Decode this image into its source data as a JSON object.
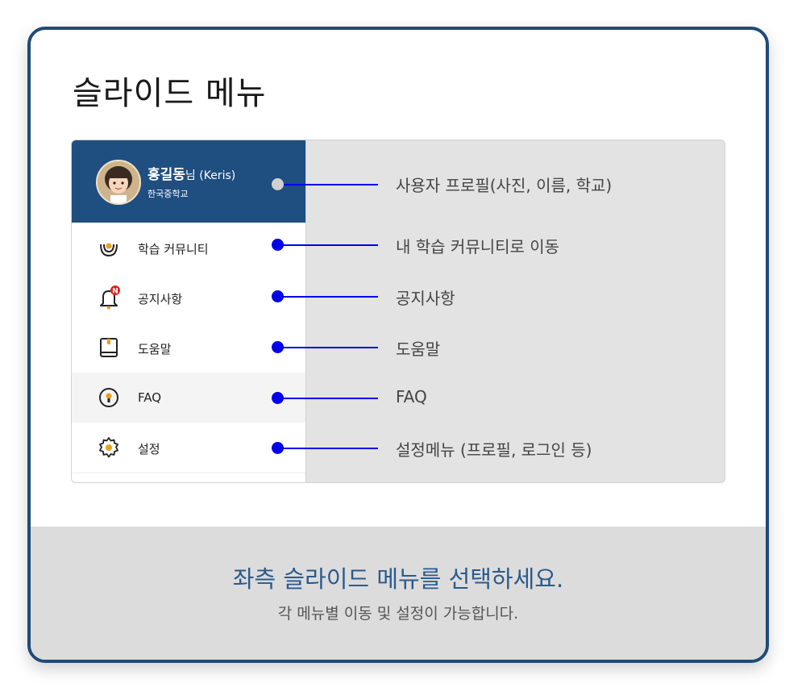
{
  "title": "슬라이드 메뉴",
  "profile": {
    "name": "홍길동",
    "suffix": "님 (Keris)",
    "school": "한국중학교"
  },
  "menu": [
    {
      "label": "학습 커뮤니티",
      "icon": "community-icon"
    },
    {
      "label": "공지사항",
      "icon": "bell-icon",
      "badge": "N"
    },
    {
      "label": "도움말",
      "icon": "book-icon"
    },
    {
      "label": "FAQ",
      "icon": "faq-icon"
    },
    {
      "label": "설정",
      "icon": "gear-icon"
    }
  ],
  "callouts": [
    "사용자 프로필(사진, 이름, 학교)",
    "내 학습 커뮤니티로 이동",
    "공지사항",
    "도움말",
    "FAQ",
    "설정메뉴 (프로필, 로그인 등)"
  ],
  "footer": {
    "main": "좌측 슬라이드 메뉴를 선택하세요.",
    "sub": "각 메뉴별 이동 및 설정이 가능합니다."
  },
  "colors": {
    "accent": "#1f4e80",
    "border": "#1f4a78",
    "pointer": "#0000ee",
    "badge": "#e02020"
  }
}
